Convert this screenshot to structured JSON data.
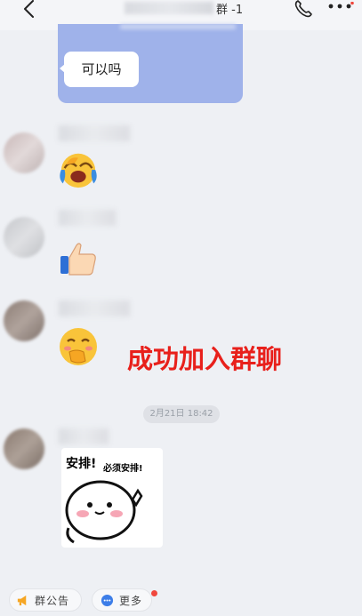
{
  "header": {
    "title_suffix": "群 -1"
  },
  "messages": {
    "reply_text": "可以吗"
  },
  "timestamp": "2月21日 18:42",
  "overlay": {
    "caption": "成功加入群聊"
  },
  "sticker": {
    "text_large": "安排!",
    "text_small": "必须安排!"
  },
  "bottom_bar": {
    "announcement_label": "群公告",
    "more_label": "更多"
  },
  "colors": {
    "bubble_blue": "#9fb2ea",
    "accent_red": "#e8201b",
    "badge_red": "#f0473d"
  },
  "icons": [
    "back-arrow-icon",
    "phone-icon",
    "more-dots-icon",
    "megaphone-icon",
    "more-circle-icon"
  ]
}
